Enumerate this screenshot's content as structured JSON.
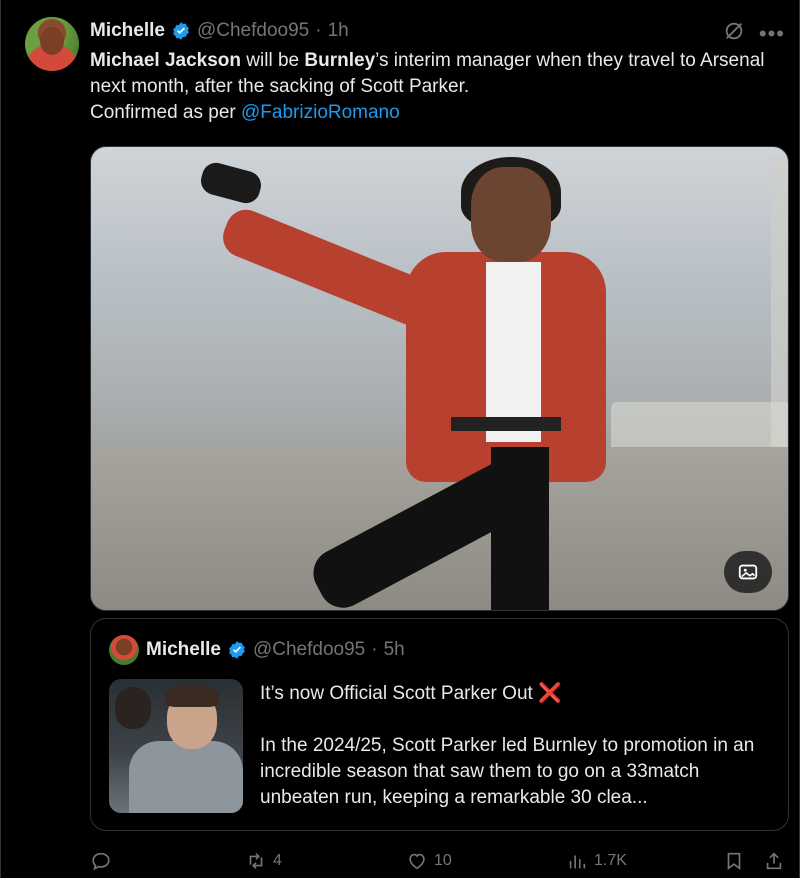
{
  "author": {
    "display_name": "Michelle",
    "handle": "@Chefdoo95",
    "separator": "·",
    "time": "1h"
  },
  "tweet": {
    "part1_bold": "Michael Jackson",
    "part2": " will be ",
    "part3_bold": "Burnley",
    "part4": "’s interim manager when they travel to Arsenal next month, after the sacking of Scott Parker.",
    "part5": "Confirmed as per ",
    "mention": "@FabrizioRomano"
  },
  "quoted": {
    "display_name": "Michelle",
    "handle": "@Chefdoo95",
    "separator": "·",
    "time": "5h",
    "line1": "It’s now Official Scott Parker Out ",
    "line1_emoji": "❌",
    "line2": "In the 2024/25, Scott Parker led Burnley to promotion in an incredible season that saw them to go on a 33match unbeaten run, keeping a remarkable 30 clea..."
  },
  "actions": {
    "replies": "",
    "retweets": "4",
    "likes": "10",
    "views": "1.7K"
  },
  "icons": [
    "verified-badge-icon",
    "grok-icon",
    "more-icon",
    "alt-text-icon",
    "reply-icon",
    "retweet-icon",
    "like-icon",
    "views-icon",
    "bookmark-icon",
    "share-icon"
  ],
  "colors": {
    "background": "#000000",
    "text": "#e7e9ea",
    "muted": "#71767b",
    "accent": "#1d9bf0",
    "border": "#2f3336"
  }
}
